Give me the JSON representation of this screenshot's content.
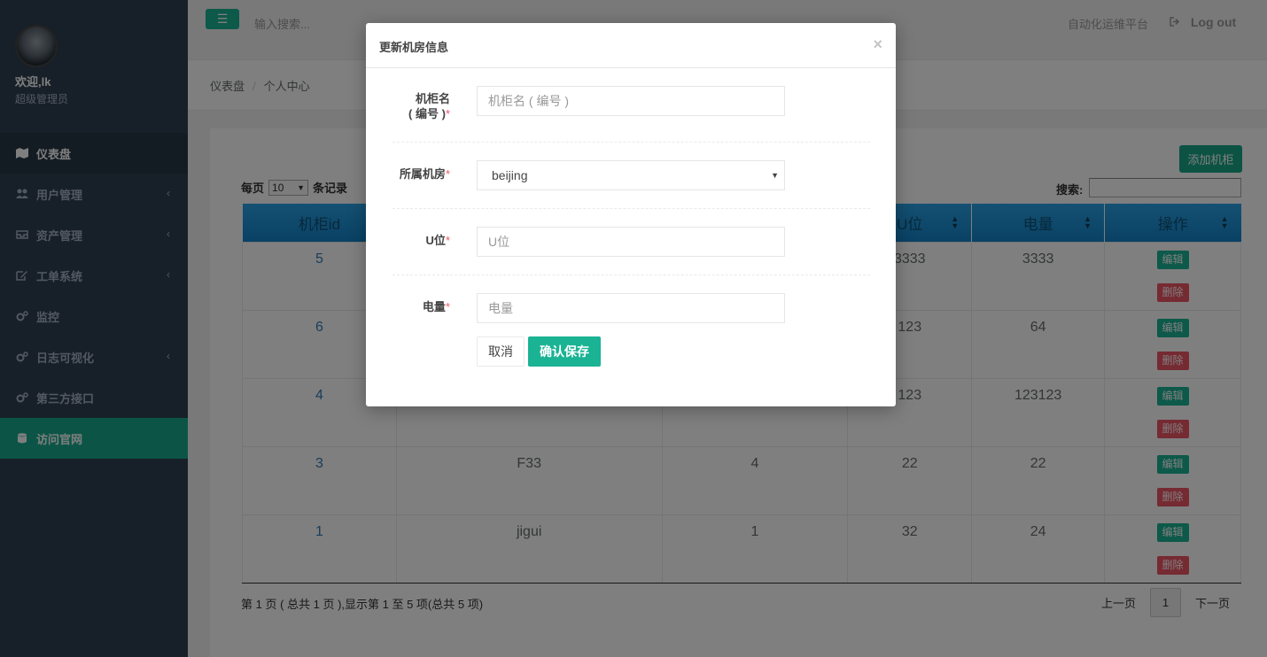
{
  "sidebar": {
    "welcome": "欢迎,lk",
    "role": "超级管理员",
    "items": [
      {
        "label": "仪表盘"
      },
      {
        "label": "用户管理"
      },
      {
        "label": "资产管理"
      },
      {
        "label": "工单系统"
      },
      {
        "label": "监控"
      },
      {
        "label": "日志可视化"
      },
      {
        "label": "第三方接口"
      },
      {
        "label": "访问官网"
      }
    ]
  },
  "topbar": {
    "search_placeholder": "输入搜索...",
    "platform": "自动化运维平台",
    "logout": "Log out"
  },
  "breadcrumb": {
    "home": "仪表盘",
    "sep": "/",
    "current": "个人中心"
  },
  "toolbar": {
    "add_label": "添加机柜",
    "per_page_prefix": "每页",
    "per_page_value": "10",
    "per_page_suffix": "条记录",
    "search_label": "搜索:"
  },
  "table": {
    "headers": [
      "机柜id",
      "",
      "",
      "U位",
      "电量",
      "操作"
    ],
    "rows": [
      {
        "id": "5",
        "name": "",
        "room": "",
        "u": "3333",
        "power": "3333"
      },
      {
        "id": "6",
        "name": "",
        "room": "",
        "u": "123",
        "power": "64"
      },
      {
        "id": "4",
        "name": "",
        "room": "",
        "u": "123",
        "power": "123123"
      },
      {
        "id": "3",
        "name": "F33",
        "room": "4",
        "u": "22",
        "power": "22"
      },
      {
        "id": "1",
        "name": "jigui",
        "room": "1",
        "u": "32",
        "power": "24"
      }
    ],
    "edit_label": "编辑",
    "delete_label": "删除"
  },
  "footer": {
    "info": "第 1 页 ( 总共 1 页 ),显示第 1 至 5 项(总共 5 项)",
    "prev": "上一页",
    "page": "1",
    "next": "下一页"
  },
  "modal": {
    "title": "更新机房信息",
    "close": "×",
    "fields": {
      "name_label_1": "机柜名",
      "name_label_2": "( 编号 )",
      "name_placeholder": "机柜名 ( 编号 )",
      "room_label": "所属机房",
      "room_value": "beijing",
      "u_label": "U位",
      "u_placeholder": "U位",
      "power_label": "电量",
      "power_placeholder": "电量",
      "required_mark": "*"
    },
    "cancel": "取消",
    "save": "确认保存"
  },
  "colors": {
    "sidebar_bg": "#2f4050",
    "accent_green": "#1ab394",
    "table_header_blue": "#1a8fd7",
    "danger_red": "#ed5565",
    "link_blue": "#337ab7"
  }
}
